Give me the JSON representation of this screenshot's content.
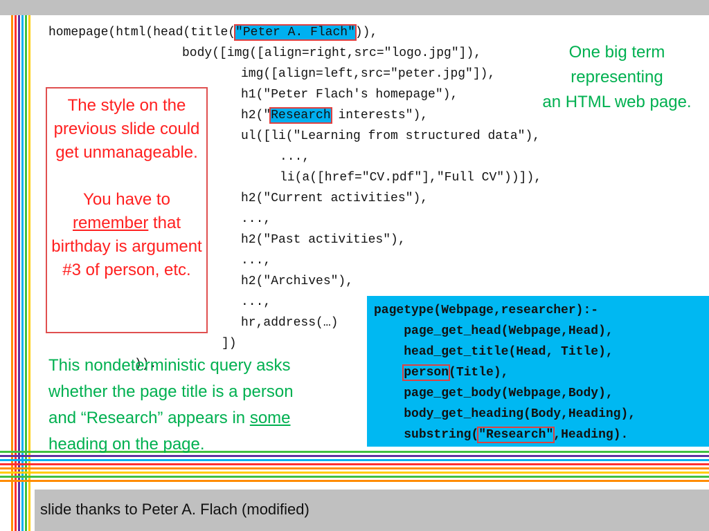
{
  "code": {
    "l1_pre": "homepage(html(head(title(",
    "l1_hl": "\"Peter A. Flach\"",
    "l1_post": ")),",
    "l2": "body([img([align=right,src=\"logo.jpg\"]),",
    "l3": "img([align=left,src=\"peter.jpg\"]),",
    "l4": "h1(\"Peter Flach's homepage\"),",
    "l5_pre": "h2(\"",
    "l5_hl": "Research",
    "l5_post": " interests\"),",
    "l6": "ul([li(\"Learning from structured data\"),",
    "l7": "...,",
    "l8": "li(a([href=\"CV.pdf\"],\"Full CV\"))]),",
    "l9": "h2(\"Current activities\"),",
    "l10": "...,",
    "l11": "h2(\"Past activities\"),",
    "l12": "...,",
    "l13": "h2(\"Archives\"),",
    "l14": "...,",
    "l15": "hr,address(…)",
    "l16": "])",
    "l17": ")).",
    "l1_hl_color": "#00b0f0"
  },
  "note_red": {
    "p1": "The style on the previous slide could get unmanageable.",
    "p2_a": "You have to",
    "p2_u": "remember",
    "p2_b": "that birthday is argument #3 of person, etc."
  },
  "note_green_top": {
    "line1": "One big term",
    "line2": "representing",
    "line3": "an HTML web page."
  },
  "note_green_bottom": {
    "line1": "This nondeterministic query asks",
    "line2": "whether the page title is a person",
    "line3_a": "and “Research” appears in ",
    "line3_u": "some",
    "line4": "heading on the page."
  },
  "query": {
    "l1": "pagetype(Webpage,researcher):-",
    "l2": "page_get_head(Webpage,Head),",
    "l3": "head_get_title(Head, Title),",
    "l4_hl": "person",
    "l4_post": "(Title),",
    "l5": "page_get_body(Webpage,Body),",
    "l6": "body_get_heading(Body,Heading),",
    "l7_pre": "substring(",
    "l7_hl": "\"Research\"",
    "l7_post": ",Heading).",
    "bg_color": "#00b8f2"
  },
  "footer": {
    "text": "slide thanks to Peter A. Flach (modified)"
  }
}
